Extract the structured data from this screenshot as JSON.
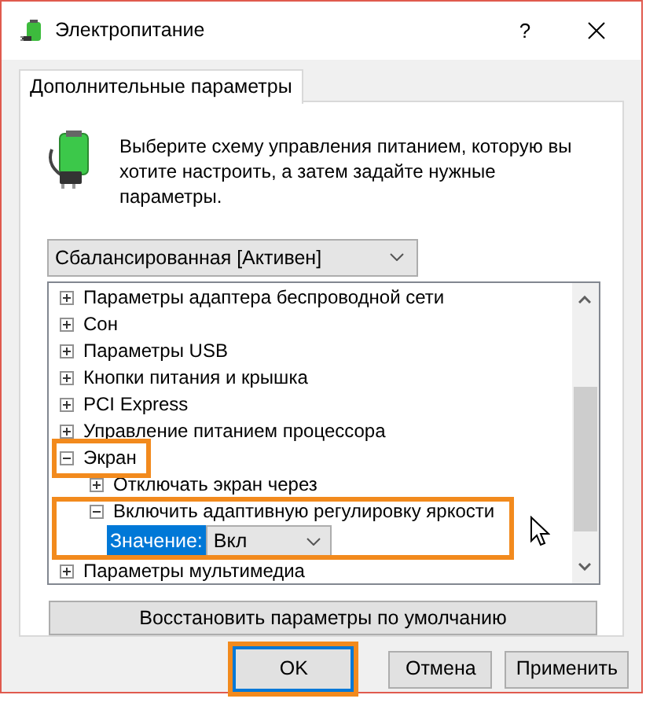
{
  "window": {
    "title": "Электропитание",
    "help": "?"
  },
  "tabs": [
    {
      "label": "Дополнительные параметры",
      "selected": true
    }
  ],
  "description": "Выберите схему управления питанием, которую вы хотите настроить, а затем задайте нужные параметры.",
  "scheme": {
    "value": "Сбалансированная [Активен]"
  },
  "tree": [
    {
      "label": "Параметры адаптера беспроводной сети",
      "expanded": false,
      "highlighted": false
    },
    {
      "label": "Сон",
      "expanded": false,
      "highlighted": false
    },
    {
      "label": "Параметры USB",
      "expanded": false,
      "highlighted": false
    },
    {
      "label": "Кнопки питания и крышка",
      "expanded": false,
      "highlighted": false
    },
    {
      "label": "PCI Express",
      "expanded": false,
      "highlighted": false
    },
    {
      "label": "Управление питанием процессора",
      "expanded": false,
      "highlighted": false
    },
    {
      "label": "Экран",
      "expanded": true,
      "highlighted": true,
      "children": [
        {
          "label": "Отключать экран через",
          "expanded": false,
          "highlighted": false
        },
        {
          "label": "Включить адаптивную регулировку яркости",
          "expanded": true,
          "highlighted": true,
          "children": [
            {
              "kind": "setting",
              "label": "Значение:",
              "value": "Вкл"
            }
          ]
        }
      ]
    },
    {
      "label": "Параметры мультимедиа",
      "expanded": false,
      "highlighted": false
    }
  ],
  "restore_button": "Восстановить параметры по умолчанию",
  "buttons": [
    {
      "label": "OK",
      "highlight": true
    },
    {
      "label": "Отмена",
      "highlight": false
    },
    {
      "label": "Применить",
      "highlight": false
    }
  ]
}
